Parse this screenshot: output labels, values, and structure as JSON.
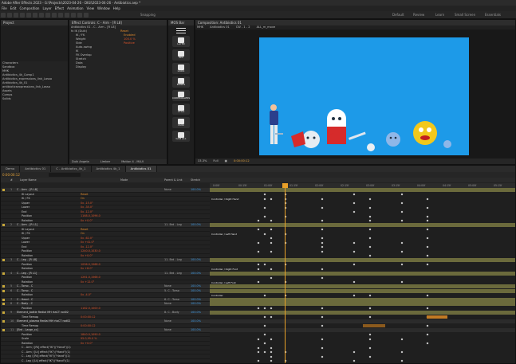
{
  "app": {
    "title": "Adobe After Effects 2023 - G:\\Projects\\2023-04-26 - DIGI\\2023-04-26 - Antibiotics.aep *",
    "menus": [
      "File",
      "Edit",
      "Composition",
      "Layer",
      "Effect",
      "Animation",
      "View",
      "Window",
      "Help"
    ],
    "workspaces": [
      "Default",
      "Review",
      "Learn",
      "Small Screen",
      "Essentials"
    ],
    "snapping": "Snapping"
  },
  "project_panel": {
    "tab": "Project",
    "items": [
      "Characters",
      "Sandbox",
      "MHK",
      "Antibiotics_4k_Comp1",
      "Antibiotics_expressions_link_Lasso",
      "Antibiotics_4k_01",
      "antibioticsexpressions_link_Lasso",
      "Assets",
      "Comps",
      "Solids"
    ]
  },
  "effect_controls": {
    "tab": "Effect Controls: C - Arm - [R L8]",
    "path": "Antibiotics 01 - C - Arm - [R L8]",
    "effect_name": "fx IK (Duik)",
    "reset": "Reset",
    "rows": [
      {
        "label": "IK / FK",
        "value": "Enabled"
      },
      {
        "label": "Weight",
        "value": "100.0 %"
      },
      {
        "label": "Side",
        "value": "Positive"
      },
      {
        "label": "Auto-swing",
        "value": ""
      },
      {
        "label": "IK",
        "value": ""
      },
      {
        "label": "FK Overlap",
        "value": ""
      },
      {
        "label": "Stretch",
        "value": ""
      },
      {
        "label": "Data",
        "value": ""
      },
      {
        "label": "Display",
        "value": ""
      }
    ],
    "footer": [
      "Duik Angela",
      "Limber",
      "Motion 4 - MLUI"
    ]
  },
  "duik_panel": {
    "tab": "MOS Bar",
    "buttons": [
      "LAYER",
      "RIG",
      "LINKS",
      "BONES",
      "CONTROLLERS",
      "UTILS",
      "DUIK",
      "CAM ALL"
    ]
  },
  "composition_panel": {
    "tab": "Composition: Antibiotics 01",
    "breadcrumb": [
      "MHK",
      "Antibiotics 01",
      "CW - 1 - 2",
      "ALL_m_move"
    ],
    "view_tab": "Antibiotics 01",
    "zoom": "33.3%",
    "quality": "Full",
    "timecode": "0:00:00:12",
    "camera": "Active Camera",
    "views": "1 View",
    "background_color": "#1d9ae8"
  },
  "timeline": {
    "tabs": [
      "Demo",
      "Antibiotics 01",
      "C - Antibiotics_4k_1",
      "Antibiotics 4k_1",
      "Antibiotics 01"
    ],
    "timecode": "0:00:00:12",
    "columns": [
      "#",
      "Layer Name",
      "Parent & Link",
      "Mode",
      "Stretch"
    ],
    "ruler": [
      "0:00f",
      "00:15f",
      "01:00f",
      "01:15f",
      "02:00f",
      "02:15f",
      "03:00f",
      "03:15f",
      "04:00f",
      "04:15f",
      "05:00f",
      "05:15f"
    ],
    "layers": [
      {
        "type": "layer",
        "num": "1",
        "name": "C - Arm - [R L8]",
        "parent": "None",
        "stretch": "100.0%"
      },
      {
        "type": "sub",
        "name": "IK Layout",
        "value": "Reset"
      },
      {
        "type": "sub",
        "name": "IK / FK",
        "value": "On"
      },
      {
        "type": "sub",
        "name": "Upper",
        "value": "0x -15.0°"
      },
      {
        "type": "sub",
        "name": "Lower",
        "value": "0x -35.0°"
      },
      {
        "type": "sub",
        "name": "End",
        "value": "0x -12.0°"
      },
      {
        "type": "sub",
        "name": "Position",
        "value": "1168.0,1096.0"
      },
      {
        "type": "sub",
        "name": "Rotation",
        "value": "0x +0.0°"
      },
      {
        "type": "layer",
        "num": "2",
        "name": "C - Arm - [R L1]",
        "parent": "11. Brd - Leg",
        "stretch": "100.0%"
      },
      {
        "type": "sub",
        "name": "IK Layout",
        "value": "Reset"
      },
      {
        "type": "sub",
        "name": "IK / FK",
        "value": "On"
      },
      {
        "type": "sub",
        "name": "Upper",
        "value": "0x -62.0°"
      },
      {
        "type": "sub",
        "name": "Lower",
        "value": "0x +41.0°"
      },
      {
        "type": "sub",
        "name": "End",
        "value": "0x -12.0°"
      },
      {
        "type": "sub",
        "name": "Position",
        "value": "1240.0,1030.0"
      },
      {
        "type": "sub",
        "name": "Rotation",
        "value": "0x +0.0°"
      },
      {
        "type": "layer",
        "num": "3",
        "name": "C - Leg - [R L8]",
        "parent": "11. Brd - Leg",
        "stretch": "100.0%"
      },
      {
        "type": "sub",
        "name": "Position",
        "value": "1096.0,1568.0"
      },
      {
        "type": "sub",
        "name": "Rotation",
        "value": "0x +8.0°"
      },
      {
        "type": "layer",
        "num": "4",
        "name": "C - Leg - [R L1]",
        "parent": "11. Brd - Leg",
        "stretch": "100.0%"
      },
      {
        "type": "sub",
        "name": "Position",
        "value": "1261.0,1568.0"
      },
      {
        "type": "sub",
        "name": "Rotation",
        "value": "0x +12.0°"
      },
      {
        "type": "layer",
        "num": "5",
        "name": "C - Torso - C",
        "parent": "None",
        "stretch": "100.0%"
      },
      {
        "type": "layer",
        "num": "6",
        "name": "C - Torso - C",
        "parent": "5. C - Torso",
        "stretch": "100.0%"
      },
      {
        "type": "sub",
        "name": "Rotation",
        "value": "0x -4.0°"
      },
      {
        "type": "layer",
        "num": "7",
        "name": "C - Head - C",
        "parent": "6. C - Torso",
        "stretch": "100.0%"
      },
      {
        "type": "layer",
        "num": "8",
        "name": "C - Body - C",
        "parent": "None",
        "stretch": "100.0%"
      },
      {
        "type": "sub",
        "name": "Position",
        "value": "1182.0,1000.0"
      },
      {
        "type": "layer",
        "num": "9",
        "name": "Element_bottle Redial MH rtaCT rod02",
        "parent": "8. C - Body",
        "stretch": "100.0%"
      },
      {
        "type": "sub",
        "name": "Time Remap",
        "value": "0:00:00:12"
      },
      {
        "type": "layer",
        "num": "10",
        "name": "Element_plasma Redial MH rtaCT rod02",
        "parent": "None",
        "stretch": "100.0%"
      },
      {
        "type": "sub",
        "name": "Time Remap",
        "value": "0:00:00:12"
      },
      {
        "type": "layer",
        "num": "11",
        "name": "[Brd - Large_cc]",
        "parent": "None",
        "stretch": "100.0%"
      },
      {
        "type": "sub",
        "name": "Position",
        "value": "1840.0,1090.0"
      },
      {
        "type": "sub",
        "name": "Scale",
        "value": "95.0,95.0 %"
      },
      {
        "type": "sub",
        "name": "Rotation",
        "value": "0x +0.0°"
      },
      {
        "type": "sub",
        "name": "C - Arm / [Rt] effect(\"IK\")(\"Hand\")(1)",
        "value": ""
      },
      {
        "type": "sub",
        "name": "C - Arm / [Lt] effect(\"IK\")(\"Hand\")(1)",
        "value": ""
      },
      {
        "type": "sub",
        "name": "C - Leg / [Rt] effect(\"IK\")(\"Hand\")(1)",
        "value": ""
      },
      {
        "type": "sub",
        "name": "C - Leg / [Lt] effect(\"IK\")(\"Hand\")(1)",
        "value": ""
      }
    ],
    "bar_labels": [
      "Controller / Right Hand",
      "Controller / Left Hand",
      "Controller / Right Foot",
      "Controller / Left Foot",
      "Controller",
      "Controller"
    ]
  }
}
